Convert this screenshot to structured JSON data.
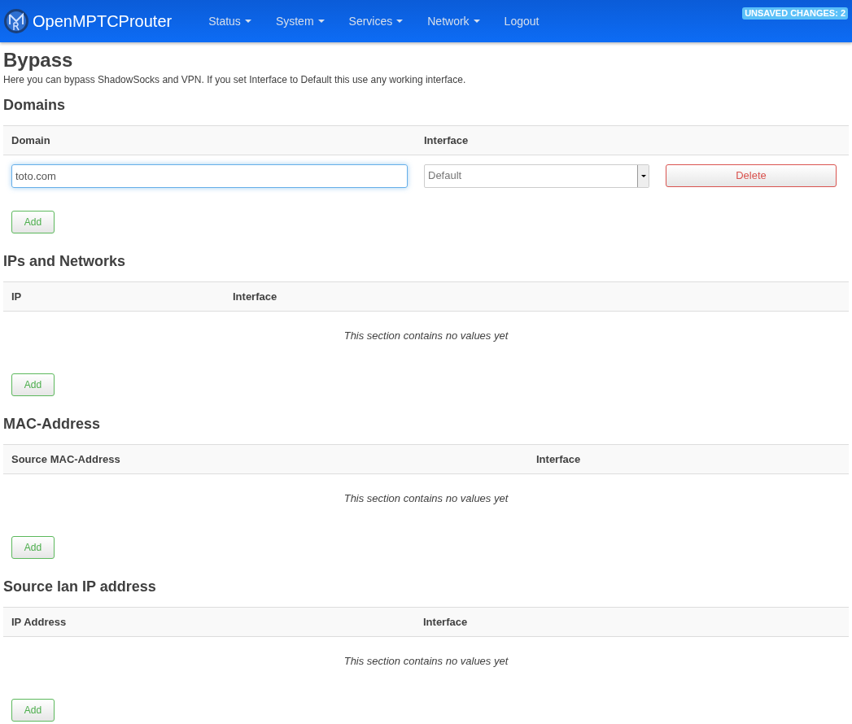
{
  "navbar": {
    "brand": "OpenMPTCProuter",
    "menu": [
      {
        "label": "Status",
        "dropdown": true
      },
      {
        "label": "System",
        "dropdown": true
      },
      {
        "label": "Services",
        "dropdown": true
      },
      {
        "label": "Network",
        "dropdown": true
      },
      {
        "label": "Logout",
        "dropdown": false
      }
    ],
    "badge": "UNSAVED CHANGES: 2"
  },
  "page": {
    "title": "Bypass",
    "description": "Here you can bypass ShadowSocks and VPN. If you set Interface to Default this use any working interface."
  },
  "sections": [
    {
      "title": "Domains",
      "columns": [
        "Domain",
        "Interface"
      ],
      "rows": [
        {
          "domain": "toto.com",
          "interface": "Default",
          "delete": "Delete"
        }
      ],
      "add": "Add"
    },
    {
      "title": "IPs and Networks",
      "columns": [
        "IP",
        "Interface"
      ],
      "empty_text": "This section contains no values yet",
      "add": "Add"
    },
    {
      "title": "MAC-Address",
      "columns": [
        "Source MAC-Address",
        "Interface"
      ],
      "empty_text": "This section contains no values yet",
      "add": "Add"
    },
    {
      "title": "Source lan IP address",
      "columns": [
        "IP Address",
        "Interface"
      ],
      "empty_text": "This section contains no values yet",
      "add": "Add"
    }
  ]
}
